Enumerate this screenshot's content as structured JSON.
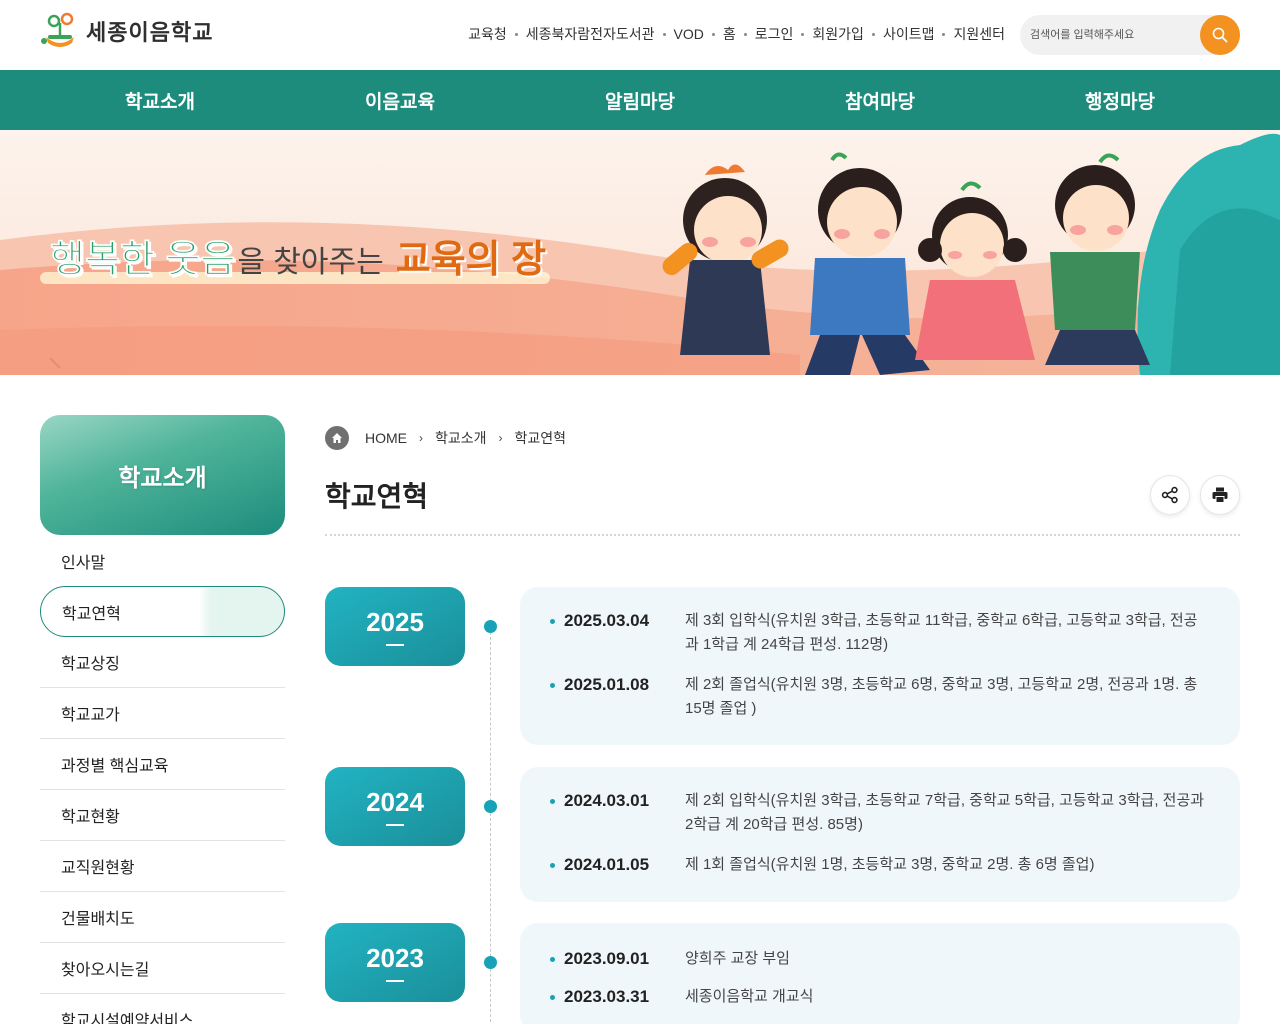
{
  "header": {
    "logo_text": "세종이음학교",
    "util_links": [
      {
        "label": "교육청"
      },
      {
        "label": "세종북자람전자도서관"
      },
      {
        "label": "VOD"
      },
      {
        "label": "홈"
      },
      {
        "label": "로그인"
      },
      {
        "label": "회원가입"
      },
      {
        "label": "사이트맵"
      },
      {
        "label": "지원센터"
      }
    ],
    "search": {
      "placeholder": "검색어를 입력해주세요"
    }
  },
  "gnb": {
    "items": [
      {
        "label": "학교소개"
      },
      {
        "label": "이음교육"
      },
      {
        "label": "알림마당"
      },
      {
        "label": "참여마당"
      },
      {
        "label": "행정마당"
      }
    ]
  },
  "banner": {
    "slogan_part1": "행복한 웃음",
    "slogan_part2": "을 찾아주는",
    "slogan_part3": "교육의 장"
  },
  "sidebar": {
    "title": "학교소개",
    "items": [
      {
        "label": "인사말"
      },
      {
        "label": "학교연혁"
      },
      {
        "label": "학교상징"
      },
      {
        "label": "학교교가"
      },
      {
        "label": "과정별 핵심교육"
      },
      {
        "label": "학교현황"
      },
      {
        "label": "교직원현황"
      },
      {
        "label": "건물배치도"
      },
      {
        "label": "찾아오시는길"
      },
      {
        "label": "학교시설예약서비스"
      }
    ],
    "active_index": 1
  },
  "breadcrumb": {
    "home": "HOME",
    "level1": "학교소개",
    "level2": "학교연혁"
  },
  "page": {
    "title": "학교연혁"
  },
  "history": [
    {
      "year": "2025",
      "events": [
        {
          "date": "2025.03.04",
          "desc": "제 3회 입학식(유치원 3학급, 초등학교 11학급, 중학교 6학급, 고등학교 3학급, 전공과 1학급 계 24학급 편성. 112명)"
        },
        {
          "date": "2025.01.08",
          "desc": "제 2회 졸업식(유치원 3명, 초등학교 6명, 중학교 3명, 고등학교 2명, 전공과 1명. 총 15명 졸업 )"
        }
      ]
    },
    {
      "year": "2024",
      "events": [
        {
          "date": "2024.03.01",
          "desc": "제 2회 입학식(유치원 3학급, 초등학교 7학급, 중학교 5학급, 고등학교 3학급, 전공과 2학급 계 20학급 편성. 85명)"
        },
        {
          "date": "2024.01.05",
          "desc": "제 1회 졸업식(유치원 1명, 초등학교 3명, 중학교 2명. 총 6명 졸업)"
        }
      ]
    },
    {
      "year": "2023",
      "events": [
        {
          "date": "2023.09.01",
          "desc": "양희주 교장 부임"
        },
        {
          "date": "2023.03.31",
          "desc": "세종이음학교 개교식"
        }
      ]
    }
  ],
  "colors": {
    "primary_green": "#1d8c7c",
    "accent_orange": "#f39121",
    "year_teal": "#1fa6b5",
    "card_bg": "#f0f7fb"
  }
}
